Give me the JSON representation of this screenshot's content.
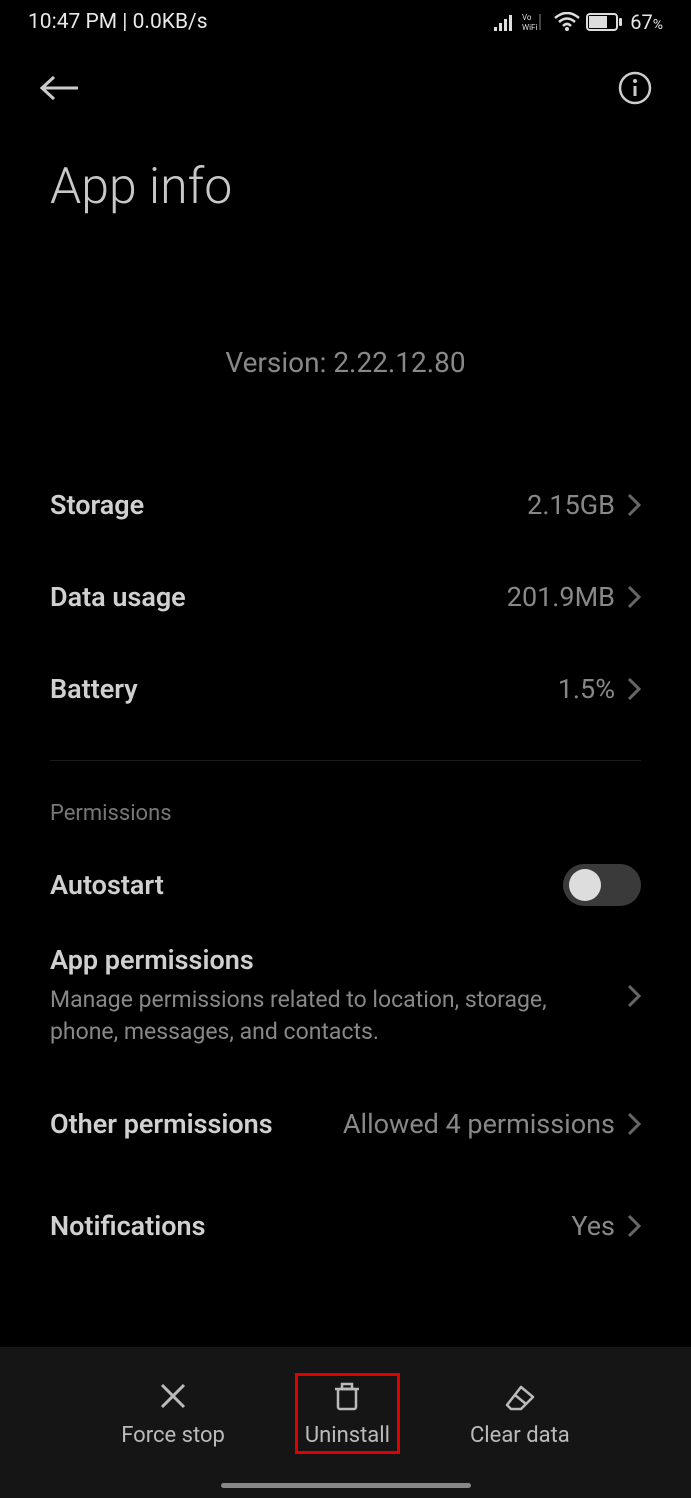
{
  "status": {
    "left": "10:47 PM | 0.0KB/s",
    "battery_pct": "67",
    "battery_suffix": "%"
  },
  "header": {
    "title": "App info"
  },
  "app": {
    "version_label": "Version: 2.22.12.80"
  },
  "rows": {
    "storage": {
      "label": "Storage",
      "value": "2.15GB"
    },
    "data_usage": {
      "label": "Data usage",
      "value": "201.9MB"
    },
    "battery": {
      "label": "Battery",
      "value": "1.5%"
    }
  },
  "permissions": {
    "section_label": "Permissions",
    "autostart": {
      "label": "Autostart"
    },
    "app_permissions": {
      "label": "App permissions",
      "subtitle": "Manage permissions related to location, storage, phone, messages, and contacts."
    },
    "other_permissions": {
      "label": "Other permissions",
      "value": "Allowed 4 permissions"
    },
    "notifications": {
      "label": "Notifications",
      "value": "Yes"
    }
  },
  "bottom_actions": {
    "force_stop": "Force stop",
    "uninstall": "Uninstall",
    "clear_data": "Clear data"
  }
}
